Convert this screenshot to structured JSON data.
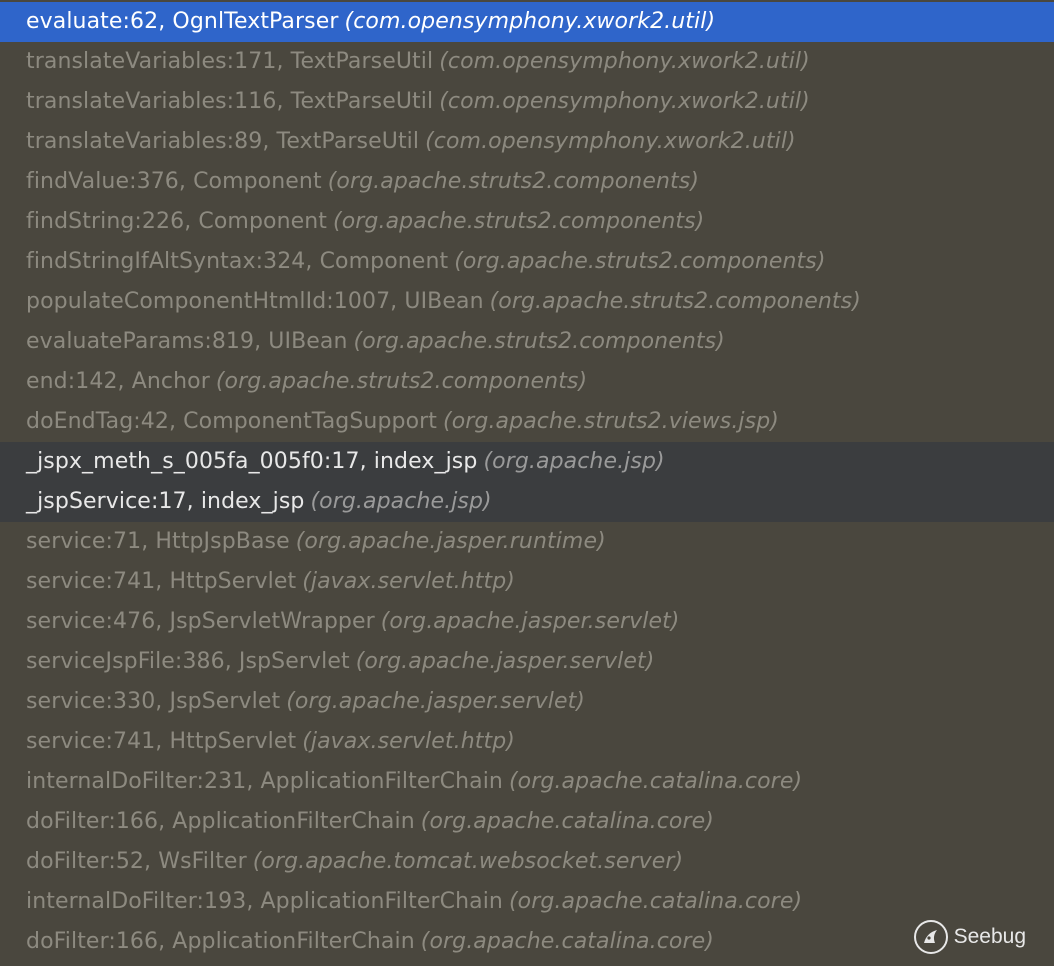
{
  "frames": [
    {
      "method": "evaluate:62, OgnlTextParser",
      "package": "(com.opensymphony.xwork2.util)",
      "state": "selected"
    },
    {
      "method": "translateVariables:171, TextParseUtil",
      "package": "(com.opensymphony.xwork2.util)",
      "state": "library"
    },
    {
      "method": "translateVariables:116, TextParseUtil",
      "package": "(com.opensymphony.xwork2.util)",
      "state": "library"
    },
    {
      "method": "translateVariables:89, TextParseUtil",
      "package": "(com.opensymphony.xwork2.util)",
      "state": "library"
    },
    {
      "method": "findValue:376, Component",
      "package": "(org.apache.struts2.components)",
      "state": "library"
    },
    {
      "method": "findString:226, Component",
      "package": "(org.apache.struts2.components)",
      "state": "library"
    },
    {
      "method": "findStringIfAltSyntax:324, Component",
      "package": "(org.apache.struts2.components)",
      "state": "library"
    },
    {
      "method": "populateComponentHtmlId:1007, UIBean",
      "package": "(org.apache.struts2.components)",
      "state": "library"
    },
    {
      "method": "evaluateParams:819, UIBean",
      "package": "(org.apache.struts2.components)",
      "state": "library"
    },
    {
      "method": "end:142, Anchor",
      "package": "(org.apache.struts2.components)",
      "state": "library"
    },
    {
      "method": "doEndTag:42, ComponentTagSupport",
      "package": "(org.apache.struts2.views.jsp)",
      "state": "library"
    },
    {
      "method": "_jspx_meth_s_005fa_005f0:17, index_jsp",
      "package": "(org.apache.jsp)",
      "state": "user"
    },
    {
      "method": "_jspService:17, index_jsp",
      "package": "(org.apache.jsp)",
      "state": "user"
    },
    {
      "method": "service:71, HttpJspBase",
      "package": "(org.apache.jasper.runtime)",
      "state": "library"
    },
    {
      "method": "service:741, HttpServlet",
      "package": "(javax.servlet.http)",
      "state": "library"
    },
    {
      "method": "service:476, JspServletWrapper",
      "package": "(org.apache.jasper.servlet)",
      "state": "library"
    },
    {
      "method": "serviceJspFile:386, JspServlet",
      "package": "(org.apache.jasper.servlet)",
      "state": "library"
    },
    {
      "method": "service:330, JspServlet",
      "package": "(org.apache.jasper.servlet)",
      "state": "library"
    },
    {
      "method": "service:741, HttpServlet",
      "package": "(javax.servlet.http)",
      "state": "library"
    },
    {
      "method": "internalDoFilter:231, ApplicationFilterChain",
      "package": "(org.apache.catalina.core)",
      "state": "library"
    },
    {
      "method": "doFilter:166, ApplicationFilterChain",
      "package": "(org.apache.catalina.core)",
      "state": "library"
    },
    {
      "method": "doFilter:52, WsFilter",
      "package": "(org.apache.tomcat.websocket.server)",
      "state": "library"
    },
    {
      "method": "internalDoFilter:193, ApplicationFilterChain",
      "package": "(org.apache.catalina.core)",
      "state": "library"
    },
    {
      "method": "doFilter:166, ApplicationFilterChain",
      "package": "(org.apache.catalina.core)",
      "state": "library"
    }
  ],
  "watermark": {
    "brand": "Seebug",
    "icon": "seebug-logo-icon"
  },
  "colors": {
    "background": "#4a473e",
    "selected": "#2f65ca",
    "user_frame": "#3b3d3f",
    "dimmed_text": "#8d8a80"
  }
}
